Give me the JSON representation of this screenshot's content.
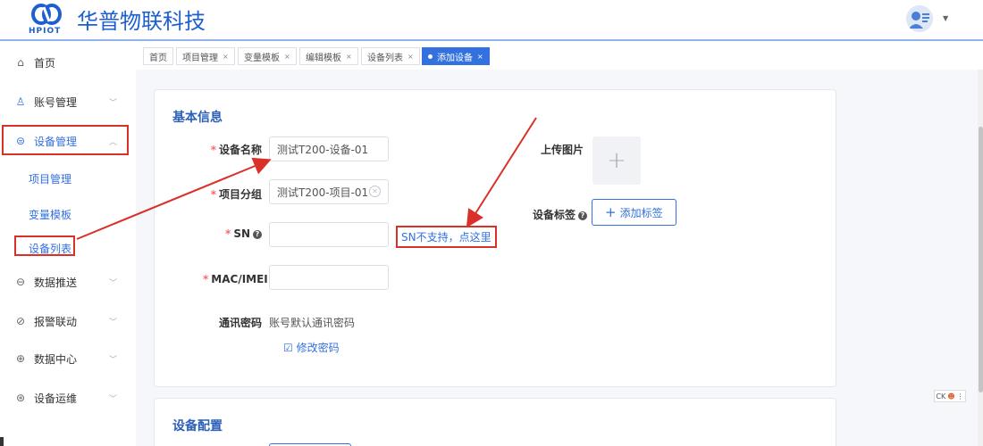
{
  "header": {
    "logo_small": "HPIOT",
    "brand": "华普物联科技",
    "dropdown_caret": "▼"
  },
  "sidebar": {
    "items": [
      {
        "label": "首页",
        "icon": "home-icon"
      },
      {
        "label": "账号管理",
        "icon": "user-icon"
      },
      {
        "label": "设备管理",
        "icon": "device-icon"
      },
      {
        "label": "数据推送",
        "icon": "push-icon"
      },
      {
        "label": "报警联动",
        "icon": "alarm-icon"
      },
      {
        "label": "数据中心",
        "icon": "datacenter-icon"
      },
      {
        "label": "设备运维",
        "icon": "maintenance-icon"
      }
    ],
    "sub_items": [
      "项目管理",
      "变量模板",
      "设备列表"
    ]
  },
  "tabs": [
    {
      "label": "首页",
      "closable": false
    },
    {
      "label": "项目管理",
      "closable": true
    },
    {
      "label": "变量模板",
      "closable": true
    },
    {
      "label": "编辑模板",
      "closable": true
    },
    {
      "label": "设备列表",
      "closable": true
    },
    {
      "label": "添加设备",
      "closable": true,
      "active": true
    }
  ],
  "tab_close": "×",
  "basic_info": {
    "title": "基本信息",
    "device_name_label": "设备名称",
    "device_name_value": "测试T200-设备-01",
    "project_group_label": "项目分组",
    "project_group_value": "测试T200-项目-01",
    "sn_label": "SN",
    "sn_value": "",
    "sn_link": "SN不支持，点这里",
    "mac_label": "MAC/IMEI",
    "mac_value": "",
    "password_label": "通讯密码",
    "password_value": "账号默认通讯密码",
    "change_password": "修改密码",
    "upload_label": "上传图片",
    "tag_label": "设备标签",
    "add_tag": "添加标签"
  },
  "device_config": {
    "title": "设备配置"
  },
  "widget": {
    "text": "CK"
  },
  "colors": {
    "primary": "#3370e0",
    "brand": "#1d5fd0",
    "annotation": "#d9302a",
    "required": "#f56c6c"
  }
}
